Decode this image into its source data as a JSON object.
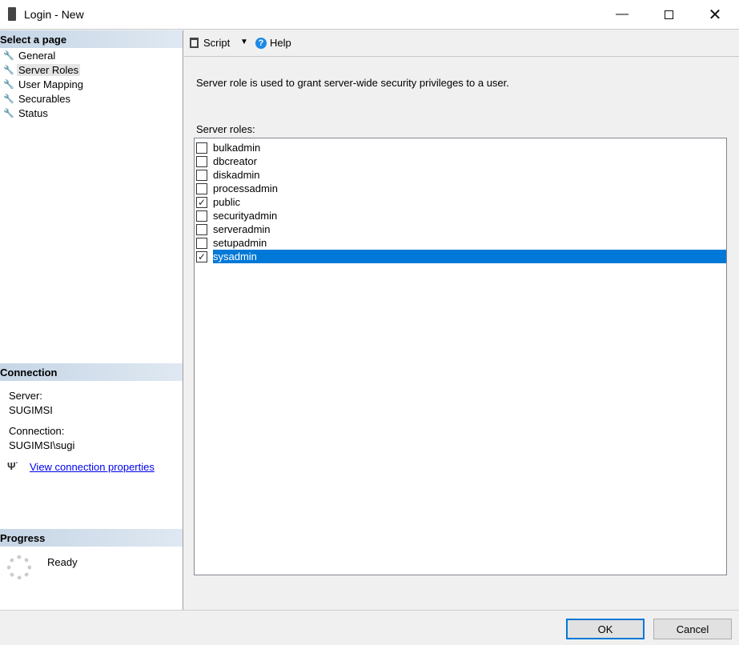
{
  "window": {
    "title": "Login - New"
  },
  "sidebar": {
    "select_page_header": "Select a page",
    "pages": [
      {
        "label": "General"
      },
      {
        "label": "Server Roles"
      },
      {
        "label": "User Mapping"
      },
      {
        "label": "Securables"
      },
      {
        "label": "Status"
      }
    ],
    "connection_header": "Connection",
    "server_label": "Server:",
    "server_value": "SUGIMSI",
    "connection_label": "Connection:",
    "connection_value": "SUGIMSI\\sugi",
    "view_connection_link": "View connection properties",
    "progress_header": "Progress",
    "progress_status": "Ready"
  },
  "toolbar": {
    "script_label": "Script",
    "help_label": "Help"
  },
  "main": {
    "description": "Server role is used to grant server-wide security privileges to a user.",
    "roles_label": "Server roles:",
    "roles": [
      {
        "name": "bulkadmin",
        "checked": false
      },
      {
        "name": "dbcreator",
        "checked": false
      },
      {
        "name": "diskadmin",
        "checked": false
      },
      {
        "name": "processadmin",
        "checked": false
      },
      {
        "name": "public",
        "checked": true
      },
      {
        "name": "securityadmin",
        "checked": false
      },
      {
        "name": "serveradmin",
        "checked": false
      },
      {
        "name": "setupadmin",
        "checked": false
      },
      {
        "name": "sysadmin",
        "checked": true,
        "selected": true
      }
    ]
  },
  "buttons": {
    "ok": "OK",
    "cancel": "Cancel"
  }
}
